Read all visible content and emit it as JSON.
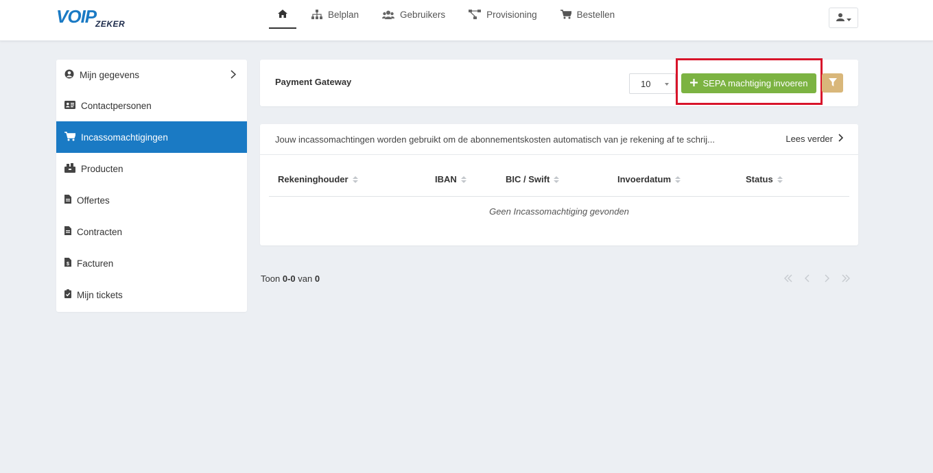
{
  "brand": {
    "logo_main": "VOIP",
    "logo_sub": "ZEKER"
  },
  "nav": {
    "items": [
      {
        "label": "",
        "icon": "home-icon"
      },
      {
        "label": "Belplan",
        "icon": "sitemap-icon"
      },
      {
        "label": "Gebruikers",
        "icon": "users-icon"
      },
      {
        "label": "Provisioning",
        "icon": "network-icon"
      },
      {
        "label": "Bestellen",
        "icon": "cart-icon"
      }
    ]
  },
  "sidebar": {
    "items": [
      {
        "label": "Mijn gegevens",
        "icon": "user-circle-icon"
      },
      {
        "label": "Contactpersonen",
        "icon": "id-card-icon"
      },
      {
        "label": "Incassomachtigingen",
        "icon": "cart-icon",
        "active": true
      },
      {
        "label": "Producten",
        "icon": "box-icon"
      },
      {
        "label": "Offertes",
        "icon": "file-icon"
      },
      {
        "label": "Contracten",
        "icon": "file-icon"
      },
      {
        "label": "Facturen",
        "icon": "invoice-icon"
      },
      {
        "label": "Mijn tickets",
        "icon": "clipboard-check-icon"
      }
    ]
  },
  "header": {
    "title": "Payment Gateway",
    "per_page": "10",
    "sepa_button": "SEPA machtiging invoeren"
  },
  "info": {
    "text": "Jouw incassomachtingen worden gebruikt om de abonnementskosten automatisch van je rekening af te schrij...",
    "read_more": "Lees verder"
  },
  "table": {
    "columns": [
      "Rekeninghouder",
      "IBAN",
      "BIC / Swift",
      "Invoerdatum",
      "Status"
    ],
    "empty_message": "Geen Incassomachtiging gevonden"
  },
  "footer": {
    "prefix": "Toon",
    "from": "0",
    "dash": "-",
    "to": "0",
    "of": "van",
    "total": "0"
  },
  "colors": {
    "primary": "#1a7ac4",
    "success": "#7cb342",
    "filter": "#d9b77a",
    "highlight": "#d8142a"
  }
}
